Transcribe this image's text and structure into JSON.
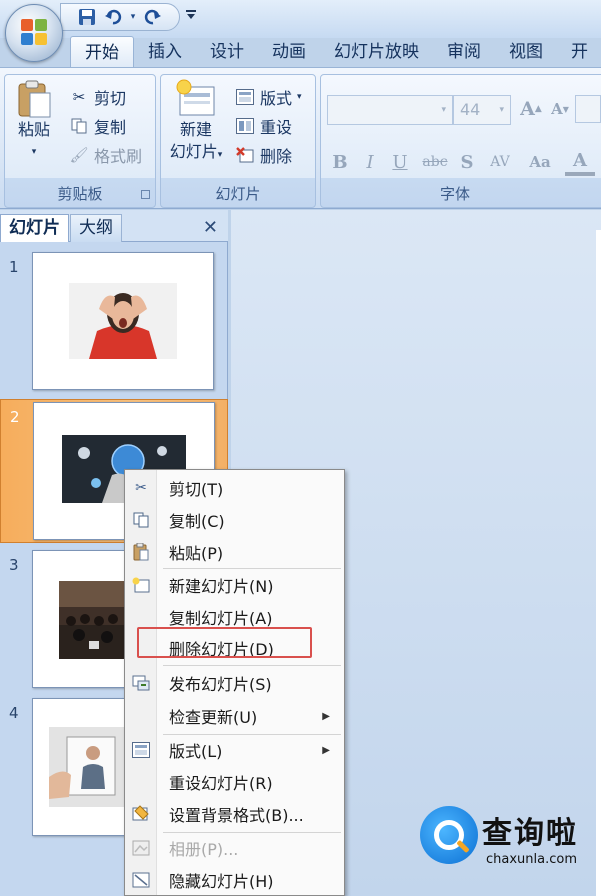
{
  "quick_access": {
    "save": "save-icon",
    "undo": "undo-icon",
    "redo": "redo-icon",
    "more": "customize-icon"
  },
  "tabs": [
    "开始",
    "插入",
    "设计",
    "动画",
    "幻灯片放映",
    "审阅",
    "视图",
    "开"
  ],
  "ribbon": {
    "clipboard": {
      "label": "剪贴板",
      "paste": "粘贴",
      "cut": "剪切",
      "copy": "复制",
      "format_painter": "格式刷"
    },
    "slides": {
      "label": "幻灯片",
      "new_slide_line1": "新建",
      "new_slide_line2": "幻灯片",
      "layout": "版式",
      "reset": "重设",
      "delete": "删除"
    },
    "font": {
      "label": "字体",
      "size": "44",
      "bold": "B",
      "italic": "I",
      "underline": "U",
      "strike": "abc",
      "shadow": "S",
      "spacing": "AV",
      "change_case": "Aa",
      "font_color": "A"
    }
  },
  "panel": {
    "tab_slides": "幻灯片",
    "tab_outline": "大纲",
    "slides": [
      {
        "num": "1"
      },
      {
        "num": "2"
      },
      {
        "num": "3"
      },
      {
        "num": "4"
      }
    ]
  },
  "context_menu": {
    "items": [
      {
        "label": "剪切(T)",
        "icon": "scissors-icon"
      },
      {
        "label": "复制(C)",
        "icon": "copy-icon"
      },
      {
        "label": "粘贴(P)",
        "icon": "paste-icon"
      },
      {
        "label": "新建幻灯片(N)",
        "icon": "new-slide-icon"
      },
      {
        "label": "复制幻灯片(A)",
        "icon": ""
      },
      {
        "label": "删除幻灯片(D)",
        "icon": ""
      },
      {
        "label": "发布幻灯片(S)",
        "icon": "publish-icon"
      },
      {
        "label": "检查更新(U)",
        "icon": ""
      },
      {
        "label": "版式(L)",
        "icon": "layout-icon"
      },
      {
        "label": "重设幻灯片(R)",
        "icon": ""
      },
      {
        "label": "设置背景格式(B)...",
        "icon": "background-icon"
      },
      {
        "label": "相册(P)...",
        "icon": "photo-album-icon"
      },
      {
        "label": "隐藏幻灯片(H)",
        "icon": "hide-slide-icon"
      }
    ]
  },
  "watermark": {
    "name": "查询啦",
    "url": "chaxunla.com"
  },
  "colors": {
    "selected_slide": "#f6ad5c",
    "highlight_box": "#d9504d",
    "ribbon_bg": "#dbe7f6"
  }
}
